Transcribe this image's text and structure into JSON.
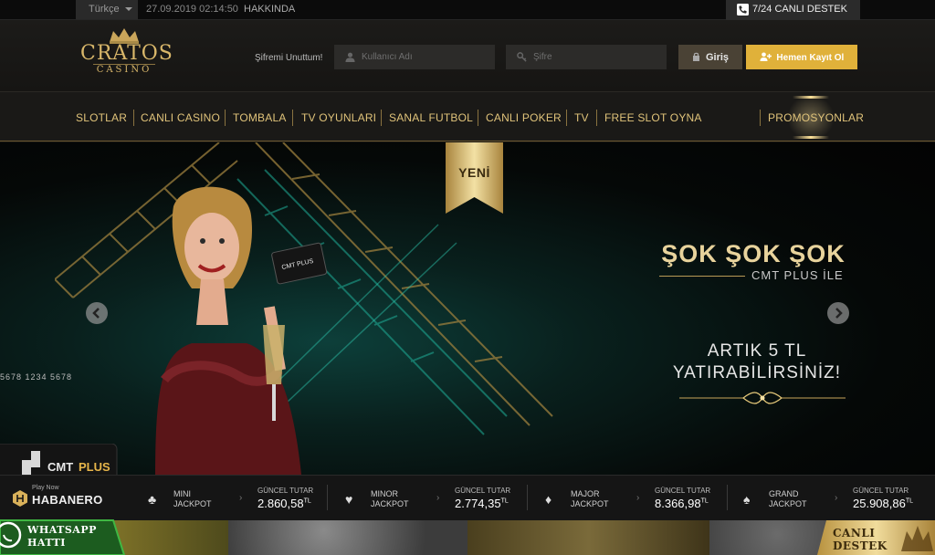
{
  "topbar": {
    "language": "Türkçe",
    "datetime": "27.09.2019 02:14:50",
    "about": "HAKKINDA",
    "support": "7/24 CANLI DESTEK"
  },
  "header": {
    "logo_name": "CRATOS",
    "logo_sub": "CASINO",
    "forgot_password": "Şifremi Unuttum!",
    "username_placeholder": "Kullanıcı Adı",
    "password_placeholder": "Şifre",
    "login": "Giriş",
    "register": "Hemen Kayıt Ol"
  },
  "nav": {
    "items": [
      "SLOTLAR",
      "CANLI CASINO",
      "TOMBALA",
      "TV OYUNLARI",
      "SANAL FUTBOL",
      "CANLI POKER",
      "TV",
      "FREE SLOT OYNA"
    ],
    "promotions": "PROMOSYONLAR"
  },
  "banner": {
    "ribbon": "YENİ",
    "headline": "ŞOK ŞOK ŞOK",
    "subline": "CMT PLUS İLE",
    "offer_line1": "ARTIK 5 TL",
    "offer_line2": "YATIRABİLİRSİNİZ!",
    "card_brand": "CMT PLUS",
    "card_digits": "5678  1234  5678"
  },
  "jackpot": {
    "provider_tag": "Play Now",
    "provider": "HABANERO",
    "current_label": "GÜNCEL TUTAR",
    "currency": "TL",
    "items": [
      {
        "name1": "MINI",
        "name2": "JACKPOT",
        "amount": "2.860,58",
        "suit": "♣"
      },
      {
        "name1": "MINOR",
        "name2": "JACKPOT",
        "amount": "2.774,35",
        "suit": "♥"
      },
      {
        "name1": "MAJOR",
        "name2": "JACKPOT",
        "amount": "8.366,98",
        "suit": "♦"
      },
      {
        "name1": "GRAND",
        "name2": "JACKPOT",
        "amount": "25.908,86",
        "suit": "♠"
      }
    ]
  },
  "footer": {
    "whatsapp1": "WHATSAPP",
    "whatsapp2": "HATTI",
    "live1": "CANLI",
    "live2": "DESTEK"
  },
  "colors": {
    "gold": "#e0c37a",
    "register_bg": "#e0b13a",
    "login_bg": "#4a4235"
  }
}
